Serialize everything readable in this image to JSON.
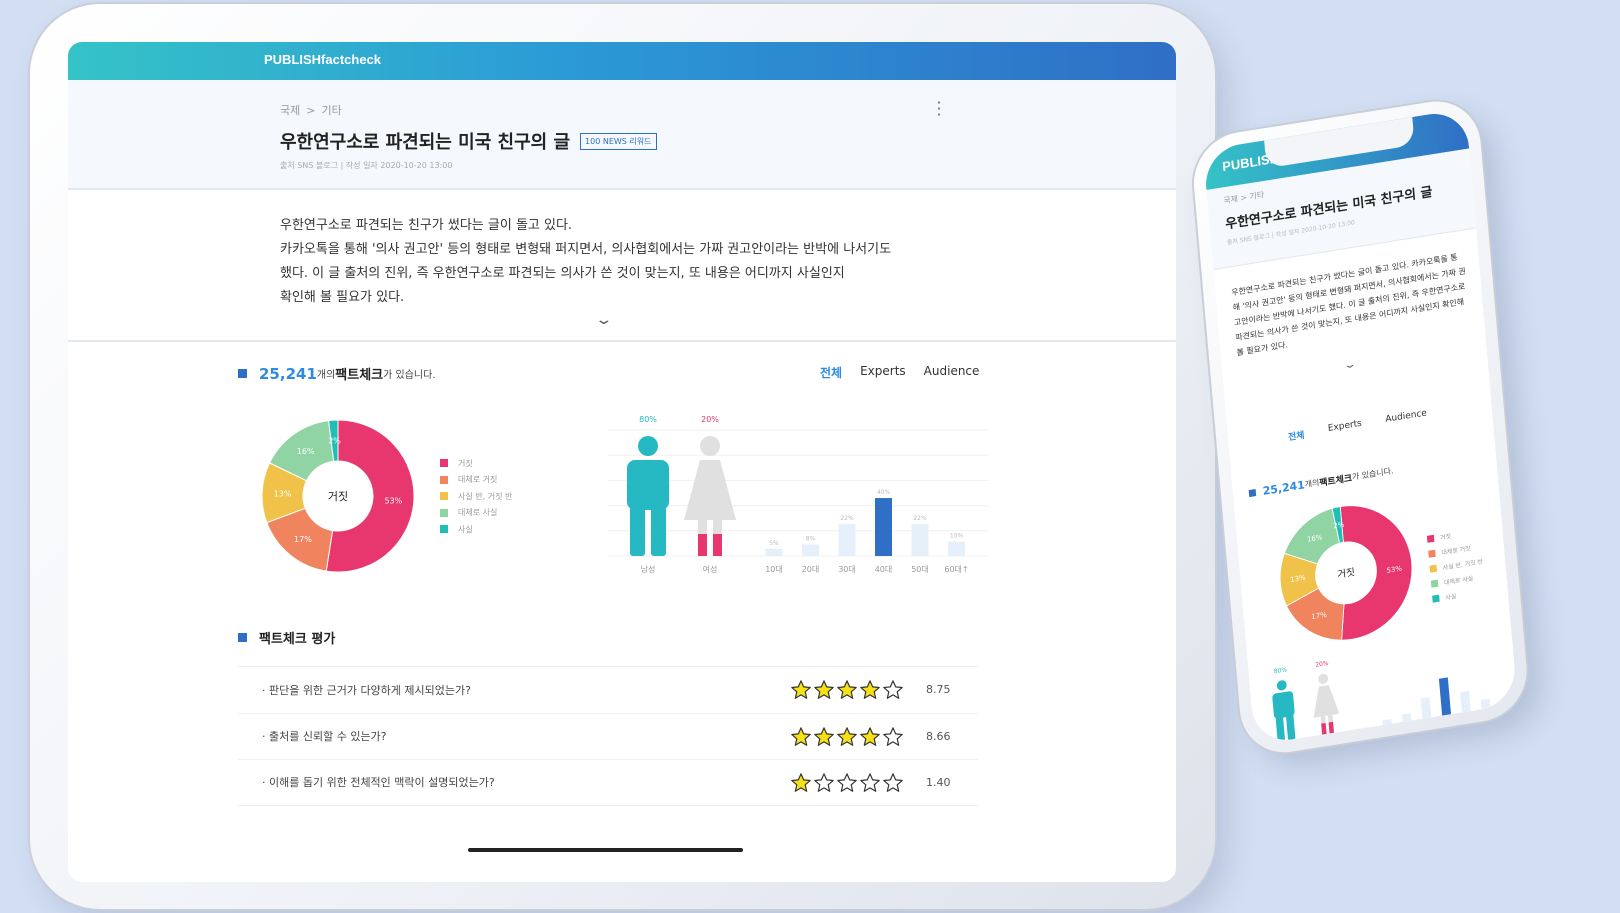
{
  "brand": "PUBLISHfactcheck",
  "breadcrumb": [
    "국제",
    "기타"
  ],
  "breadcrumb_sep": ">",
  "article": {
    "title": "우한연구소로 파견되는 미국 친구의 글",
    "badge": "100 NEWS 리워드",
    "meta": "출처  SNS  블로그   |  작성 일자 2020-10-20 13:00",
    "summary_lines": [
      "우한연구소로 파견되는 친구가 썼다는 글이 돌고 있다.",
      "카카오톡을 통해 '의사 권고안' 등의 형태로 변형돼 퍼지면서, 의사협회에서는 가짜 권고안이라는 반박에 나서기도",
      "했다. 이 글 출처의 진위, 즉 우한연구소로 파견되는 의사가 쓴 것이 맞는지, 또 내용은 어디까지 사실인지",
      "확인해 볼 필요가 있다."
    ],
    "expand_icon": "chevron-down-icon"
  },
  "factcheck": {
    "count": "25,241",
    "count_unit": "개의",
    "count_bold": "팩트체크",
    "count_suffix": "가 있습니다.",
    "tabs": [
      "전체",
      "Experts",
      "Audience"
    ],
    "active_tab": 0
  },
  "colors": {
    "false": "#e8366f",
    "mostly_false": "#f0845f",
    "half": "#f0c24a",
    "mostly_true": "#8fd4a2",
    "true": "#1fbfb5",
    "male": "#26b9c4",
    "female": "#e0e0e0",
    "accent": "#2f6fc6"
  },
  "chart_data": [
    {
      "type": "pie",
      "center_label": "거짓",
      "categories": [
        "거짓",
        "대체로 거짓",
        "사실 반, 거짓 반",
        "대체로 사실",
        "사실"
      ],
      "values": [
        53,
        17,
        13,
        16,
        2
      ],
      "labels": [
        "53%",
        "17%",
        "13%",
        "16%",
        "2%"
      ]
    },
    {
      "type": "bar",
      "categories": [
        "남성",
        "여성",
        "10대",
        "20대",
        "30대",
        "40대",
        "50대",
        "60대↑"
      ],
      "values": [
        80,
        20,
        5,
        8,
        22,
        40,
        22,
        10
      ],
      "labels": [
        "80%",
        "20%",
        "5%",
        "8%",
        "22%",
        "40%",
        "22%",
        "10%"
      ],
      "highlight": "40대"
    }
  ],
  "rating": {
    "title": "팩트체크 평가",
    "items": [
      {
        "question": "판단을 위한 근거가 다양하게 제시되었는가?",
        "stars": 4,
        "score": "8.75"
      },
      {
        "question": "출처를 신뢰할 수 있는가?",
        "stars": 4,
        "score": "8.66"
      },
      {
        "question": "이해를 돕기 위한 전체적인 맥락이 설명되었는가?",
        "stars": 1,
        "score": "1.40"
      }
    ]
  },
  "phone": {
    "brand": "PUBLISH",
    "tabs": [
      "전체",
      "Experts",
      "Audience"
    ],
    "summary": "우한연구소로 파견되는 친구가 썼다는 글이 돌고 있다. 카카오톡을 통해 '의사 권고안' 등의 형태로 변형돼 퍼지면서, 의사협회에서는 가짜 권고안이라는 반박에 나서기도 했다. 이 글 출처의 진위, 즉 우한연구소로 파견되는 의사가 쓴 것이 맞는지, 또 내용은 어디까지 사실인지 확인해 볼 필요가 있다."
  }
}
